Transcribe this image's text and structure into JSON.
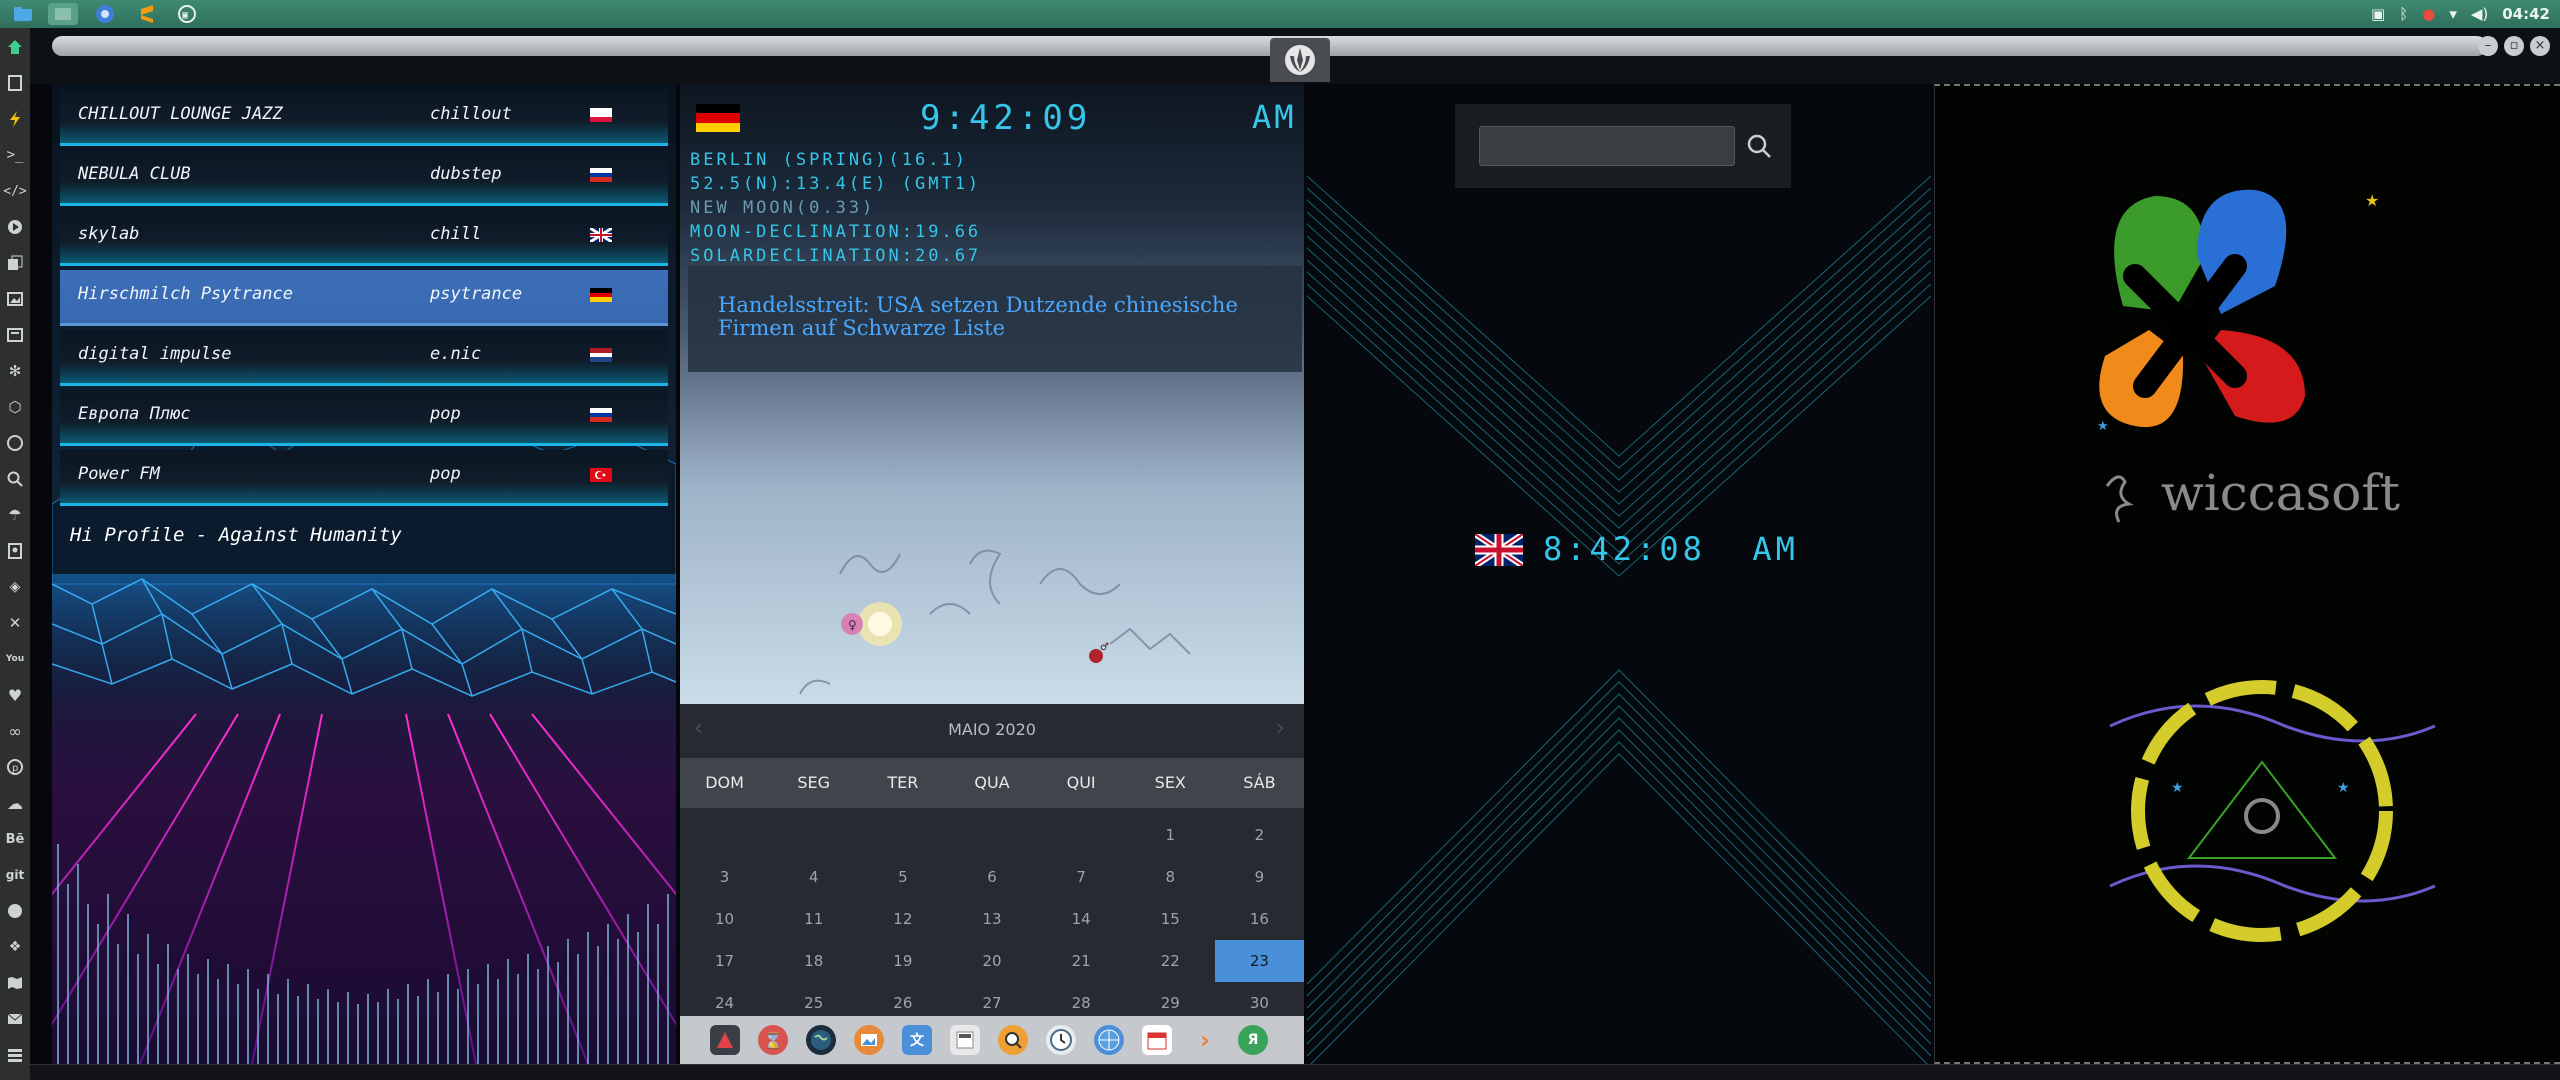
{
  "system": {
    "clock": "04:42",
    "tray_icons": [
      "screenshot-icon",
      "bluetooth-icon",
      "alert-icon",
      "wifi-icon",
      "volume-icon"
    ],
    "launchers": [
      "files-icon",
      "desktop-icon",
      "browser-icon",
      "sublime-icon",
      "terminal-icon"
    ]
  },
  "radio": {
    "stations": [
      {
        "name": "CHILLOUT LOUNGE JAZZ",
        "genre": "chillout",
        "flag": [
          "#ffffff",
          "#ffffff",
          "#dc143c"
        ]
      },
      {
        "name": "NEBULA CLUB",
        "genre": "dubstep",
        "flag": [
          "#ffffff",
          "#0039a6",
          "#d52b1e"
        ]
      },
      {
        "name": "skylab",
        "genre": "chill",
        "flag": [
          "#012169",
          "#ffffff",
          "#c8102e"
        ]
      },
      {
        "name": "Hirschmilch Psytrance",
        "genre": "psytrance",
        "flag": [
          "#000000",
          "#dd0000",
          "#ffce00"
        ]
      },
      {
        "name": "digital impulse",
        "genre": "e.nic",
        "flag": [
          "#ae1c28",
          "#ffffff",
          "#21468b"
        ]
      },
      {
        "name": "Европа Плюс",
        "genre": "pop",
        "flag": [
          "#ffffff",
          "#0039a6",
          "#d52b1e"
        ]
      },
      {
        "name": "Power FM",
        "genre": "pop",
        "flag": [
          "#e30a17",
          "#e30a17",
          "#e30a17"
        ]
      }
    ],
    "now_playing": "Hi Profile - Against Humanity"
  },
  "berlin_clock": {
    "time": "9:42:09",
    "ampm": "AM",
    "flag": [
      "#000000",
      "#dd0000",
      "#ffce00"
    ],
    "lines": [
      "BERLIN (SPRING)(16.1)",
      "52.5(N):13.4(E) (GMT1)",
      "NEW MOON(0.33)",
      "MOON-DECLINATION:19.66",
      "SOLARDECLINATION:20.67"
    ]
  },
  "news": {
    "headline": "Handelsstreit: USA setzen Dutzende chinesische Firmen auf Schwarze Liste"
  },
  "calendar": {
    "title": "MAIO 2020",
    "weekdays": [
      "DOM",
      "SEG",
      "TER",
      "QUA",
      "QUI",
      "SEX",
      "SÁB"
    ],
    "weeks": [
      [
        "",
        "",
        "",
        "",
        "",
        "1",
        "2"
      ],
      [
        "3",
        "4",
        "5",
        "6",
        "7",
        "8",
        "9"
      ],
      [
        "10",
        "11",
        "12",
        "13",
        "14",
        "15",
        "16"
      ],
      [
        "17",
        "18",
        "19",
        "20",
        "21",
        "22",
        "23"
      ],
      [
        "24",
        "25",
        "26",
        "27",
        "28",
        "29",
        "30"
      ]
    ],
    "today": "23",
    "prev": "‹",
    "next": "›"
  },
  "dock": {
    "apps": [
      "app-launcher-icon",
      "hourglass-icon",
      "earth-icon",
      "image-viewer-icon",
      "translate-icon",
      "calculator-icon",
      "search-icon",
      "clock-icon",
      "globe-icon",
      "calendar-icon",
      "arrow-icon",
      "yandex-icon"
    ]
  },
  "search": {
    "placeholder": ""
  },
  "uk_clock": {
    "time": "8:42:08",
    "ampm": "AM"
  },
  "logos": {
    "brand": "wiccasoft"
  },
  "colors": {
    "digital_cyan": "#35c6ea",
    "highlight_blue": "#4a90d9",
    "panel_teal": "#3f8a72"
  }
}
